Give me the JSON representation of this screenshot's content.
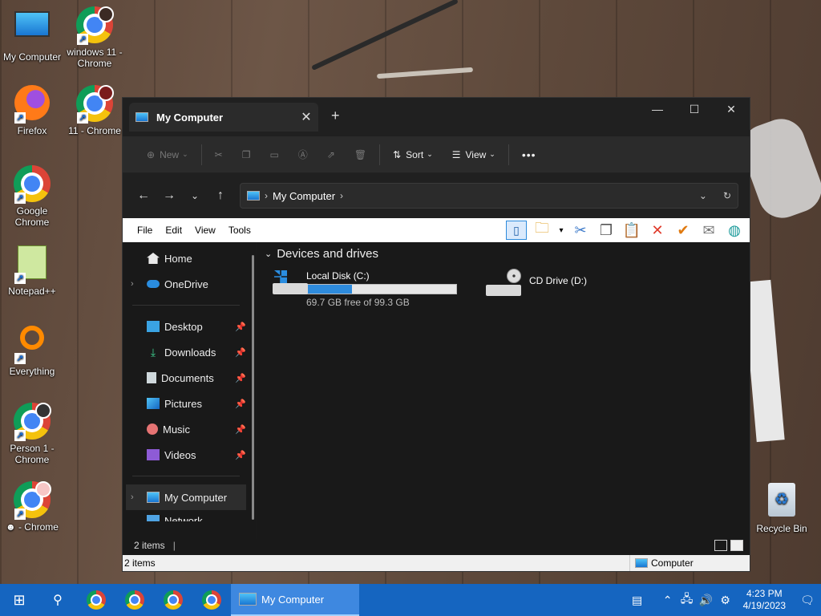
{
  "desktop": {
    "icons": [
      {
        "label": "My Computer"
      },
      {
        "label": "windows 11 - Chrome"
      },
      {
        "label": "Firefox"
      },
      {
        "label": "11 - Chrome"
      },
      {
        "label": "Google Chrome"
      },
      {
        "label": "Notepad++"
      },
      {
        "label": "Everything"
      },
      {
        "label": "Person 1 - Chrome"
      },
      {
        "label": "☻ - Chrome"
      },
      {
        "label": "Recycle Bin"
      }
    ]
  },
  "window": {
    "tab_title": "My Computer",
    "toolbar": {
      "new": "New",
      "sort": "Sort",
      "view": "View",
      "more": "•••"
    },
    "address": {
      "path": "My Computer"
    },
    "menu": [
      "File",
      "Edit",
      "View",
      "Tools"
    ],
    "nav": {
      "home": "Home",
      "onedrive": "OneDrive",
      "quick": [
        "Desktop",
        "Downloads",
        "Documents",
        "Pictures",
        "Music",
        "Videos"
      ],
      "mycomputer": "My Computer",
      "network": "Network"
    },
    "main": {
      "group": "Devices and drives",
      "drives": [
        {
          "name": "Local Disk (C:)",
          "free": "69.7 GB free of 99.3 GB",
          "used_percent": 30
        },
        {
          "name": "CD Drive (D:)"
        }
      ]
    },
    "status_count": "2 items",
    "statusbar": {
      "left": "2 items",
      "right": "Computer"
    }
  },
  "taskbar": {
    "active_app": "My Computer",
    "time": "4:23 PM",
    "date": "4/19/2023"
  },
  "colors": {
    "taskbar": "#1565c0",
    "progress": "#2e8bdc",
    "window_bg": "#191919"
  }
}
